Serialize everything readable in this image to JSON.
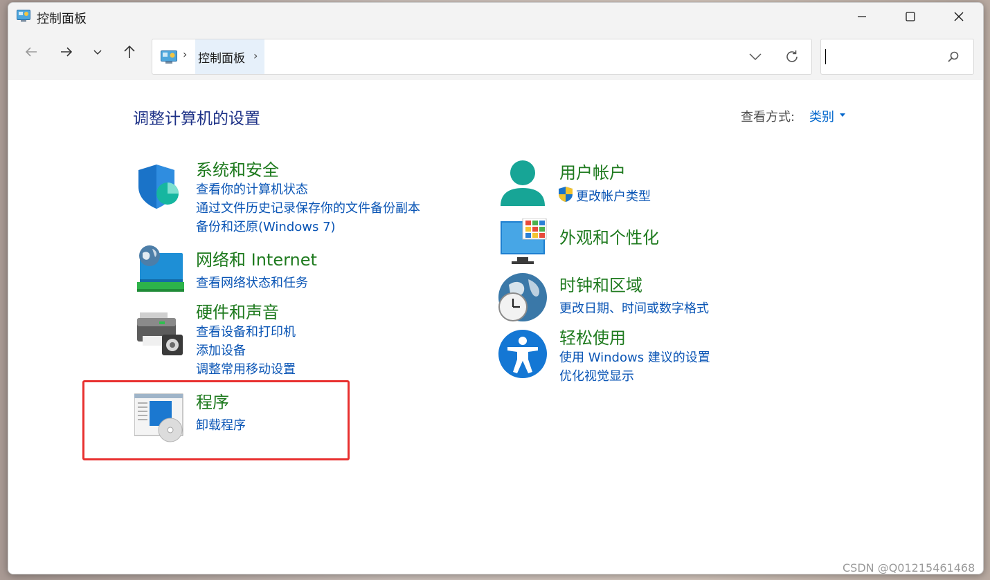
{
  "window": {
    "title": "控制面板"
  },
  "navigation": {
    "breadcrumb": "控制面板",
    "search_value": ""
  },
  "header": {
    "page_title": "调整计算机的设置",
    "view_by_label": "查看方式:",
    "view_by_value": "类别"
  },
  "categories": {
    "system_security": {
      "title": "系统和安全",
      "links": [
        "查看你的计算机状态",
        "通过文件历史记录保存你的文件备份副本",
        "备份和还原(Windows 7)"
      ]
    },
    "network": {
      "title": "网络和 Internet",
      "links": [
        "查看网络状态和任务"
      ]
    },
    "hardware_sound": {
      "title": "硬件和声音",
      "links": [
        "查看设备和打印机",
        "添加设备",
        "调整常用移动设置"
      ]
    },
    "programs": {
      "title": "程序",
      "links": [
        "卸载程序"
      ]
    },
    "user_accounts": {
      "title": "用户帐户",
      "links": [
        "更改帐户类型"
      ]
    },
    "appearance": {
      "title": "外观和个性化",
      "links": []
    },
    "clock_region": {
      "title": "时钟和区域",
      "links": [
        "更改日期、时间或数字格式"
      ]
    },
    "ease_of_access": {
      "title": "轻松使用",
      "links": [
        "使用 Windows 建议的设置",
        "优化视觉显示"
      ]
    }
  },
  "annotation": {
    "highlight_color": "#e8302f"
  },
  "watermark": "CSDN @Q01215461468",
  "colors": {
    "category_title": "#1e7a1e",
    "link": "#0a55b5",
    "page_title": "#1e3287"
  }
}
